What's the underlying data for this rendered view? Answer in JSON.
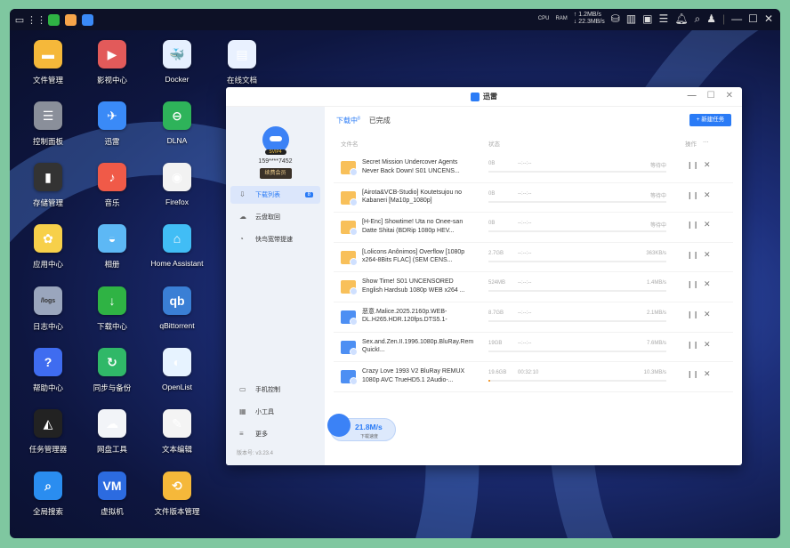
{
  "topbar": {
    "net_up": "↑ 1.2MB/s",
    "net_down": "↓ 22.3MB/s",
    "cpu_label": "CPU",
    "ram_label": "RAM"
  },
  "desktop": [
    {
      "label": "文件管理",
      "color": "#f5b83a",
      "glyph": "▬"
    },
    {
      "label": "控制面板",
      "color": "#8a8f9a",
      "glyph": "☰"
    },
    {
      "label": "存储管理",
      "color": "#333",
      "glyph": "▮"
    },
    {
      "label": "应用中心",
      "color": "#f7d04a",
      "glyph": "✿"
    },
    {
      "label": "日志中心",
      "color": "#9aa6bd",
      "glyph": "/logs"
    },
    {
      "label": "帮助中心",
      "color": "#3f6cf0",
      "glyph": "?"
    },
    {
      "label": "任务管理器",
      "color": "#222",
      "glyph": "◭"
    },
    {
      "label": "全局搜索",
      "color": "#2a8df0",
      "glyph": "⌕"
    },
    {
      "label": "影视中心",
      "color": "#e25a5a",
      "glyph": "▶"
    },
    {
      "label": "迅雷",
      "color": "#3a8af7",
      "glyph": "✈"
    },
    {
      "label": "音乐",
      "color": "#f05a48",
      "glyph": "♪"
    },
    {
      "label": "相册",
      "color": "#5db8f5",
      "glyph": "◒"
    },
    {
      "label": "下载中心",
      "color": "#2fb344",
      "glyph": "↓"
    },
    {
      "label": "同步与备份",
      "color": "#30b868",
      "glyph": "↻"
    },
    {
      "label": "网盘工具",
      "color": "#f2f4f8",
      "glyph": "☁"
    },
    {
      "label": "虚拟机",
      "color": "#2c6be0",
      "glyph": "VM"
    },
    {
      "label": "Docker",
      "color": "#e6f0ff",
      "glyph": "🐳"
    },
    {
      "label": "DLNA",
      "color": "#2eb35a",
      "glyph": "⊖"
    },
    {
      "label": "Firefox",
      "color": "#f2f2f2",
      "glyph": "◉"
    },
    {
      "label": "Home Assistant",
      "color": "#41bdf5",
      "glyph": "⌂"
    },
    {
      "label": "qBittorrent",
      "color": "#3a7fd5",
      "glyph": "qb"
    },
    {
      "label": "OpenList",
      "color": "#e7f3ff",
      "glyph": "◐"
    },
    {
      "label": "文本编辑",
      "color": "#f4f4f4",
      "glyph": "✎"
    },
    {
      "label": "文件版本管理",
      "color": "#f5b83a",
      "glyph": "⟲"
    },
    {
      "label": "在线文档",
      "color": "#e9f1ff",
      "glyph": "▤"
    }
  ],
  "window": {
    "title": "迅雷",
    "user": {
      "phone": "159****7452",
      "vip": "SVIP4",
      "renew": "续费会员"
    },
    "nav": [
      {
        "label": "下载列表",
        "count": "8"
      },
      {
        "label": "云盘取回"
      },
      {
        "label": "快鸟宽带提速"
      }
    ],
    "bottom_nav": [
      {
        "label": "手机控制"
      },
      {
        "label": "小工具"
      },
      {
        "label": "更多"
      }
    ],
    "version": "版本号: v3.23.4",
    "tabs": [
      {
        "label": "下载中",
        "count": "8"
      },
      {
        "label": "已完成"
      }
    ],
    "new_task": "+ 新建任务",
    "headers": {
      "name": "文件名",
      "status": "状态",
      "ops": "操作",
      "more": "···"
    },
    "tasks": [
      {
        "name": "Secret Mission Undercover Agents Never Back Down! S01 UNCENS...",
        "size": "0B",
        "eta": "--:--:--",
        "status": "等待中",
        "type": "folder",
        "progress": 0
      },
      {
        "name": "[Airota&VCB-Studio] Koutetsujou no Kabaneri [Ma10p_1080p]",
        "size": "0B",
        "eta": "--:--:--",
        "status": "等待中",
        "type": "folder",
        "progress": 0
      },
      {
        "name": "[H-Enc] Showtime! Uta no Onee-san Datte Shitai (BDRip 1080p HEV...",
        "size": "0B",
        "eta": "--:--:--",
        "status": "等待中",
        "type": "folder",
        "progress": 0
      },
      {
        "name": "[Lolicons Anônimos] Overflow [1080p x264-8Bits FLAC] (SEM CENS...",
        "size": "2.7GB",
        "eta": "--:--:--",
        "status": "363KB/s",
        "type": "folder",
        "progress": 0
      },
      {
        "name": "Show Time! S01 UNCENSORED English Hardsub 1080p WEB x264 ...",
        "size": "524MB",
        "eta": "--:--:--",
        "status": "1.4MB/s",
        "type": "folder",
        "progress": 0
      },
      {
        "name": "恶意.Malice.2025.2160p.WEB-DL.H265.HDR.120fps.DTS5.1-PandaQT...",
        "size": "8.7GB",
        "eta": "--:--:--",
        "status": "2.1MB/s",
        "type": "video",
        "progress": 0
      },
      {
        "name": "Sex.and.Zen.II.1996.1080p.BluRay.Remux.AVC.DD.2.0.2Audio-QuickI...",
        "size": "19GB",
        "eta": "--:--:--",
        "status": "7.6MB/s",
        "type": "video",
        "progress": 0
      },
      {
        "name": "Crazy Love 1993 V2 BluRay REMUX 1080p AVC TrueHD5.1 2Audio-...",
        "size": "19.6GB",
        "eta": "00:32:10",
        "status": "10.3MB/s",
        "type": "video",
        "progress": 1
      }
    ],
    "speed": {
      "value": "21.8M/s",
      "label": "下载速度"
    }
  }
}
